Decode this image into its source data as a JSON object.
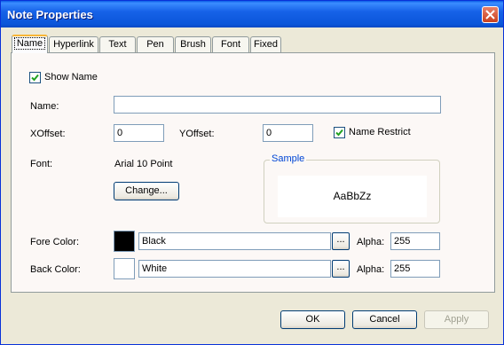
{
  "window": {
    "title": "Note Properties"
  },
  "tabs": [
    {
      "label": "Name",
      "active": true
    },
    {
      "label": "Hyperlink"
    },
    {
      "label": "Text"
    },
    {
      "label": "Pen"
    },
    {
      "label": "Brush"
    },
    {
      "label": "Font"
    },
    {
      "label": "Fixed"
    }
  ],
  "name_tab": {
    "show_name": {
      "label": "Show Name",
      "checked": true
    },
    "name": {
      "label": "Name:",
      "value": ""
    },
    "xoffset": {
      "label": "XOffset:",
      "value": "0"
    },
    "yoffset": {
      "label": "YOffset:",
      "value": "0"
    },
    "name_restrict": {
      "label": "Name Restrict",
      "checked": true
    },
    "font": {
      "label": "Font:",
      "value": "Arial 10 Point",
      "change_label": "Change..."
    },
    "sample": {
      "title": "Sample",
      "text": "AaBbZz"
    },
    "fore_color": {
      "label": "Fore Color:",
      "color_name": "Black",
      "swatch": "#000000",
      "alpha_label": "Alpha:",
      "alpha": "255",
      "browse_label": "..."
    },
    "back_color": {
      "label": "Back Color:",
      "color_name": "White",
      "swatch": "#ffffff",
      "alpha_label": "Alpha:",
      "alpha": "255",
      "browse_label": "..."
    }
  },
  "buttons": {
    "ok": "OK",
    "cancel": "Cancel",
    "apply": "Apply"
  }
}
